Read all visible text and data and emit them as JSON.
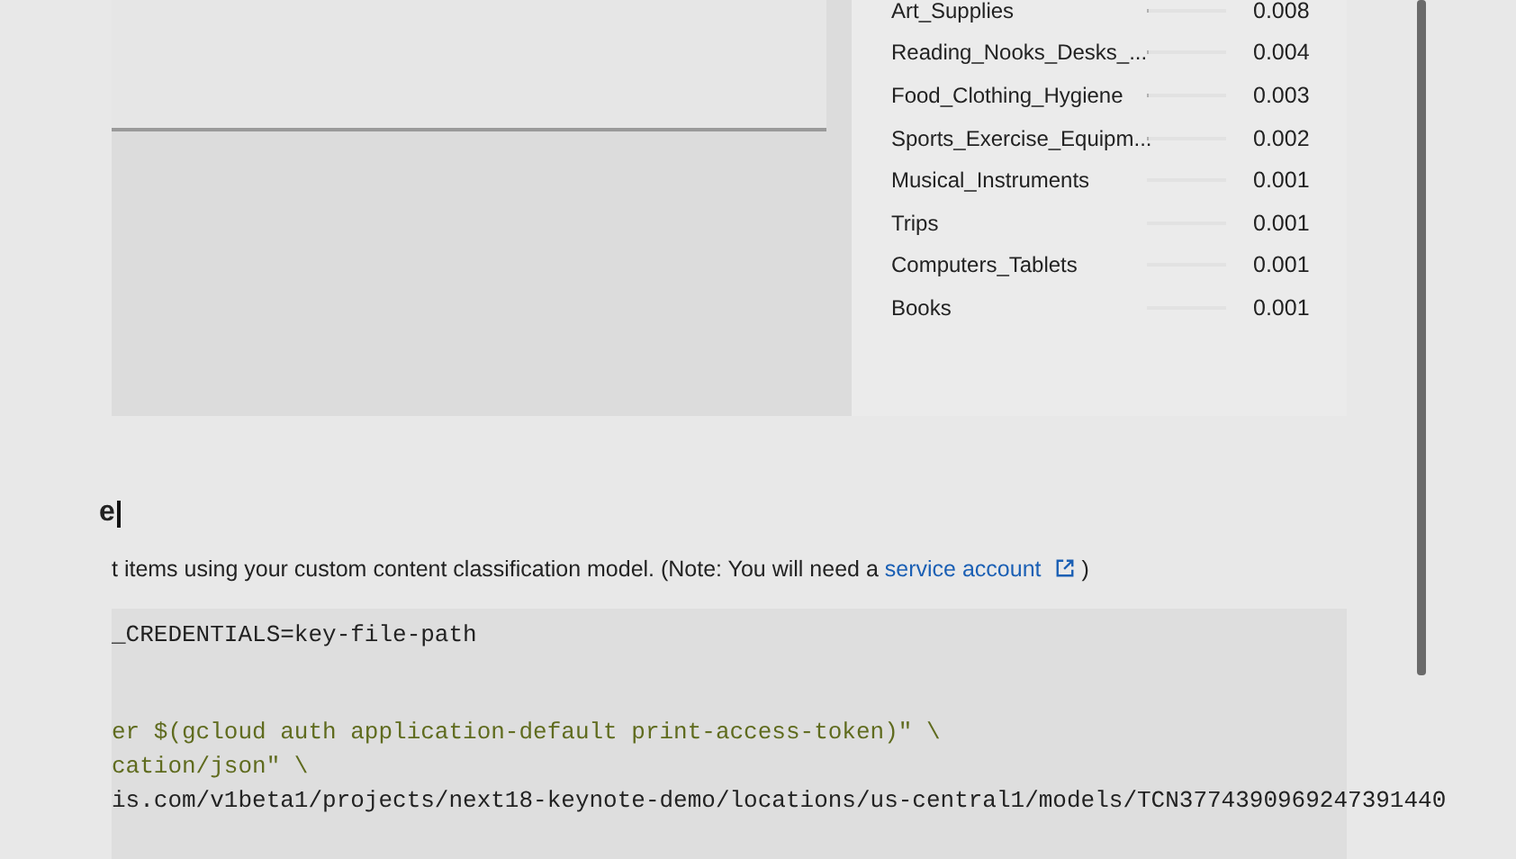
{
  "results": [
    {
      "label": "Art_Supplies",
      "level": 0.008,
      "score": "0.008"
    },
    {
      "label": "Reading_Nooks_Desks_...",
      "level": 0.004,
      "score": "0.004"
    },
    {
      "label": "Food_Clothing_Hygiene",
      "level": 0.003,
      "score": "0.003"
    },
    {
      "label": "Sports_Exercise_Equipm...",
      "level": 0.002,
      "score": "0.002"
    },
    {
      "label": "Musical_Instruments",
      "level": 0.001,
      "score": "0.001"
    },
    {
      "label": "Trips",
      "level": 0.001,
      "score": "0.001"
    },
    {
      "label": "Computers_Tablets",
      "level": 0.001,
      "score": "0.001"
    },
    {
      "label": "Books",
      "level": 0.001,
      "score": "0.001"
    }
  ],
  "heading": "e",
  "paragraph": {
    "text": "t items using your custom content classification model. (Note: You will need a ",
    "link": "service account",
    "after": " )"
  },
  "code": [
    {
      "text": "_CREDENTIALS=key-file-path",
      "kind": "plain"
    },
    {
      "kind": "blank"
    },
    {
      "text": "er $(gcloud auth application-default print-access-token)\" \\",
      "kind": "string"
    },
    {
      "text": "cation/json\" \\",
      "kind": "string"
    },
    {
      "text": "is.com/v1beta1/projects/next18-keynote-demo/locations/us-central1/models/TCN3774390969247391440",
      "kind": "plain"
    }
  ]
}
